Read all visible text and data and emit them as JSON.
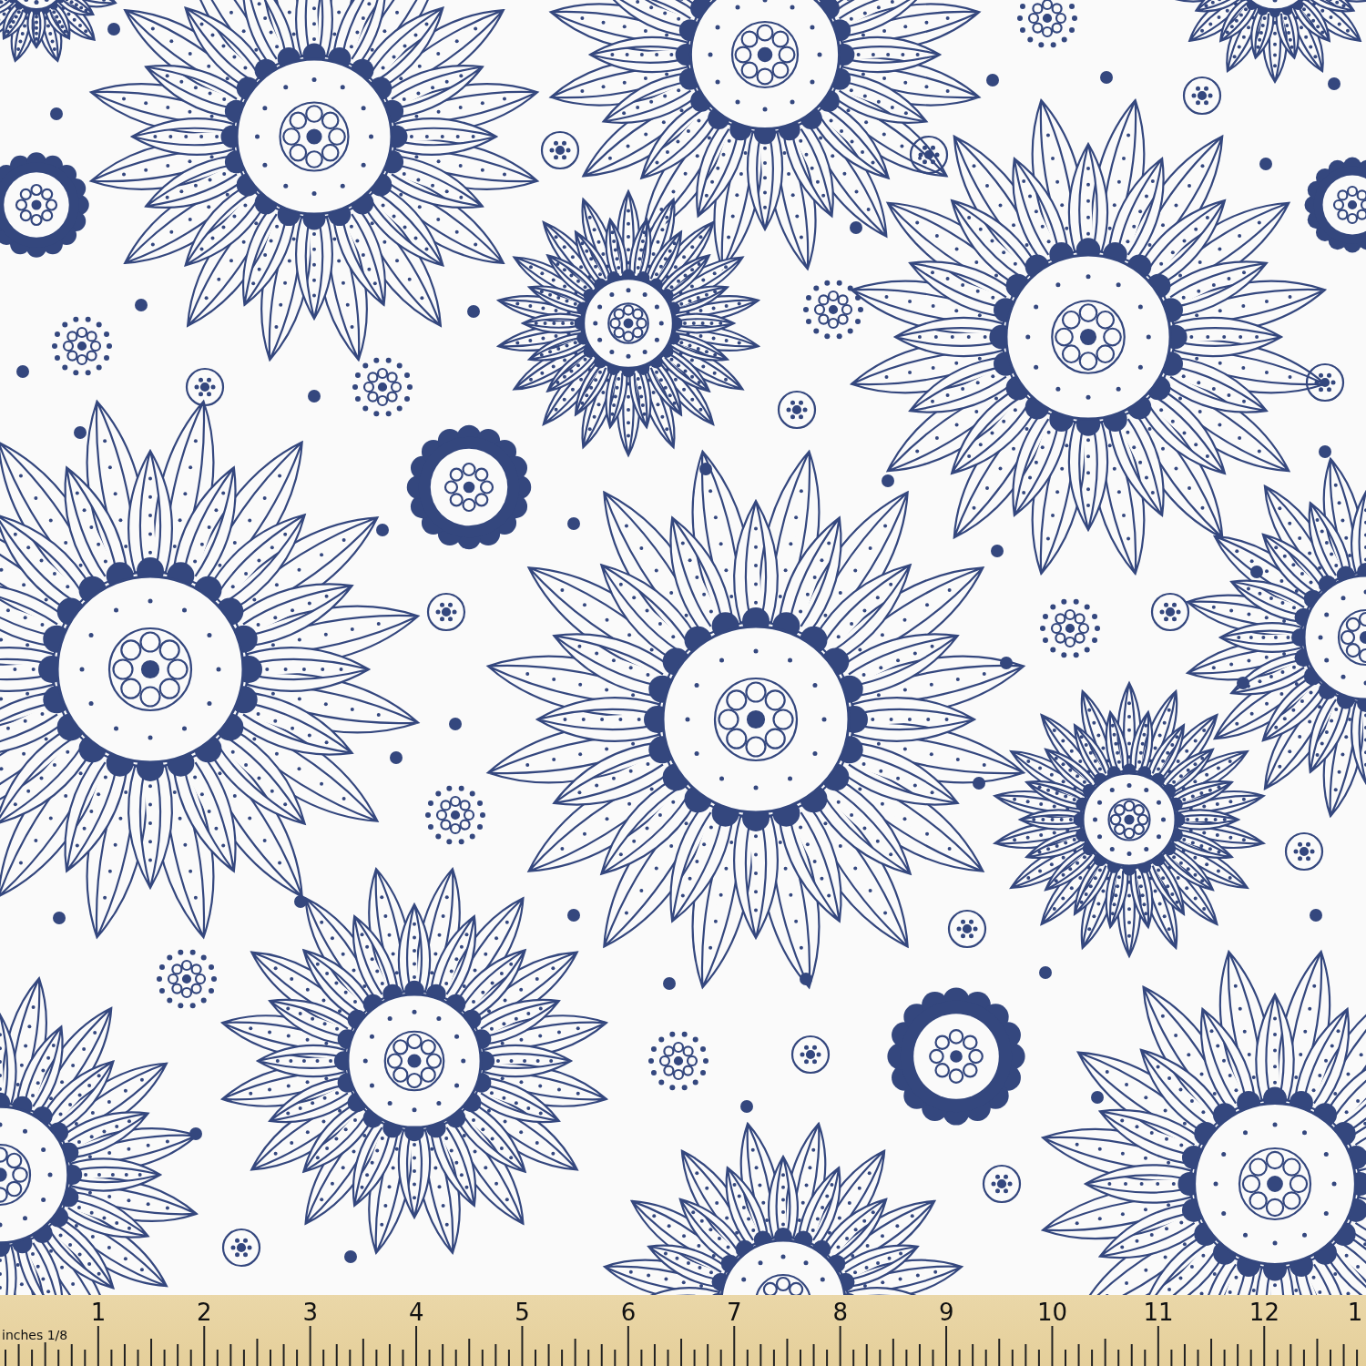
{
  "ruler": {
    "unit_label": "inches 1/8",
    "numbers": [
      "1",
      "2",
      "3",
      "4",
      "5",
      "6",
      "7",
      "8",
      "9",
      "10",
      "11",
      "12",
      "1"
    ]
  }
}
